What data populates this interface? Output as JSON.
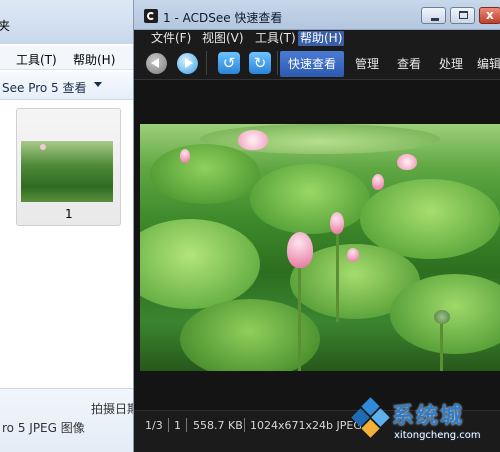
{
  "explorer": {
    "title": "夹",
    "menu": {
      "tools": "工具(T)",
      "help": "帮助(H)"
    },
    "address": "See Pro 5 查看",
    "thumbnail": {
      "label": "1"
    },
    "detail": {
      "date_label": "拍摄日期",
      "filetype": "ro 5 JPEG 图像"
    }
  },
  "acdsee": {
    "title": "1 - ACDSee 快速查看",
    "window_buttons": {
      "minimize": "minimize",
      "maximize": "maximize",
      "close": "x"
    },
    "menu": {
      "file": "文件(F)",
      "view": "视图(V)",
      "tools": "工具(T)",
      "help": "帮助(H)"
    },
    "toolbar": {
      "back_icon": "arrow-left-icon",
      "forward_icon": "arrow-right-icon",
      "rotate_left_icon": "↺",
      "rotate_right_icon": "↻"
    },
    "mode_tabs": {
      "quickview": "快速查看",
      "manage": "管理",
      "view": "查看",
      "process": "处理",
      "edit": "编辑"
    },
    "status": {
      "index": "1/3",
      "number": "1",
      "size": "558.7 KB",
      "dimensions": "1024x671x24b JPEG"
    }
  },
  "watermark": {
    "cn": "系统城",
    "url": "xitongcheng.com"
  },
  "colors": {
    "accent": "#3a5fa8",
    "tab_active": "#2d5ab0",
    "dark_bg": "#1b1b1b"
  }
}
